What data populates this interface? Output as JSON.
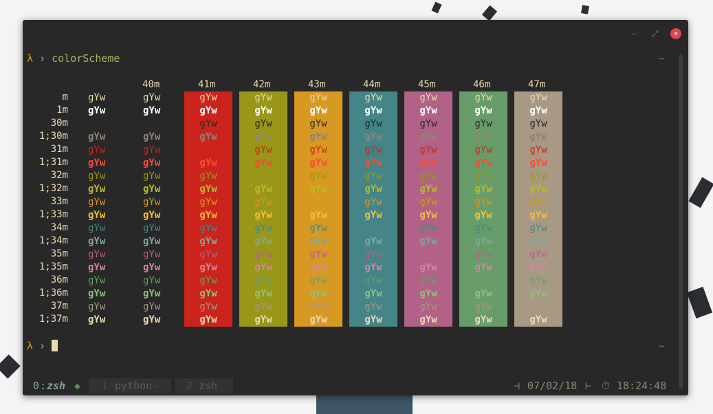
{
  "window": {
    "minimize": "–",
    "maximize": "⤢",
    "close": "×"
  },
  "terminal": {
    "prompt_symbol": "λ",
    "prompt_arrow": "›",
    "command": "colorScheme",
    "right_marker": "~"
  },
  "table": {
    "sample": "gYw",
    "bg_headers": [
      "40m",
      "41m",
      "42m",
      "43m",
      "44m",
      "45m",
      "46m",
      "47m"
    ],
    "row_labels": [
      "m",
      "1m",
      "30m",
      "1;30m",
      "31m",
      "1;31m",
      "32m",
      "1;32m",
      "33m",
      "1;33m",
      "34m",
      "1;34m",
      "35m",
      "1;35m",
      "36m",
      "1;36m",
      "37m",
      "1;37m"
    ],
    "bg_colors": [
      "#cc241d",
      "#98971a",
      "#d79921",
      "#458588",
      "#b16286",
      "#689d6a",
      "#a89984"
    ],
    "fg_colors": [
      "#ebdbb2",
      "#ffffff",
      "#282828",
      "#928374",
      "#cc241d",
      "#fb4934",
      "#98971a",
      "#b8bb26",
      "#d79921",
      "#fabd2f",
      "#458588",
      "#83a598",
      "#b16286",
      "#d3869b",
      "#689d6a",
      "#8ec07c",
      "#a89984",
      "#ebdbb2"
    ]
  },
  "statusbar": {
    "session_index": "0",
    "session_name": "zsh",
    "session_marker": "◈",
    "windows": [
      {
        "index": "1",
        "name": "python-"
      },
      {
        "index": "2",
        "name": "zsh"
      }
    ],
    "date": "07/02/18",
    "time": "18:24:48",
    "date_sep": "⊣",
    "time_sep": "⊢",
    "clock_icon": "⏱"
  },
  "colors": {
    "terminal_bg": "#282828",
    "accent": "#d79921",
    "close": "#e0434a"
  }
}
